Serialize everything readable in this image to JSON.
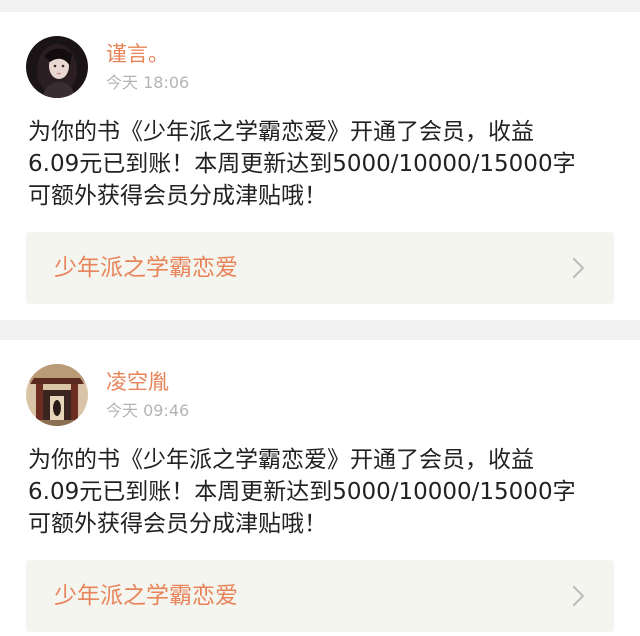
{
  "notifications": [
    {
      "user_name": "谨言。",
      "time": "今天 18:06",
      "message_lines": [
        "为你的书《少年派之学霸恋爱》开通了会员，收益",
        "6.09元已到账！本周更新达到5000/10000/15000字",
        "可额外获得会员分成津贴哦！"
      ],
      "book_title": "少年派之学霸恋爱",
      "avatar_icon": "girl-portrait-avatar"
    },
    {
      "user_name": "凌空胤",
      "time": "今天 09:46",
      "message_lines": [
        "为你的书《少年派之学霸恋爱》开通了会员，收益",
        "6.09元已到账！本周更新达到5000/10000/15000字",
        "可额外获得会员分成津贴哦！"
      ],
      "book_title": "少年派之学霸恋爱",
      "avatar_icon": "temple-scene-avatar"
    }
  ],
  "colors": {
    "accent": "#e8845a",
    "time_text": "#b4b4b4",
    "body_text": "#222222",
    "link_background": "#f5f5f0",
    "page_background": "#f2f2f2"
  }
}
